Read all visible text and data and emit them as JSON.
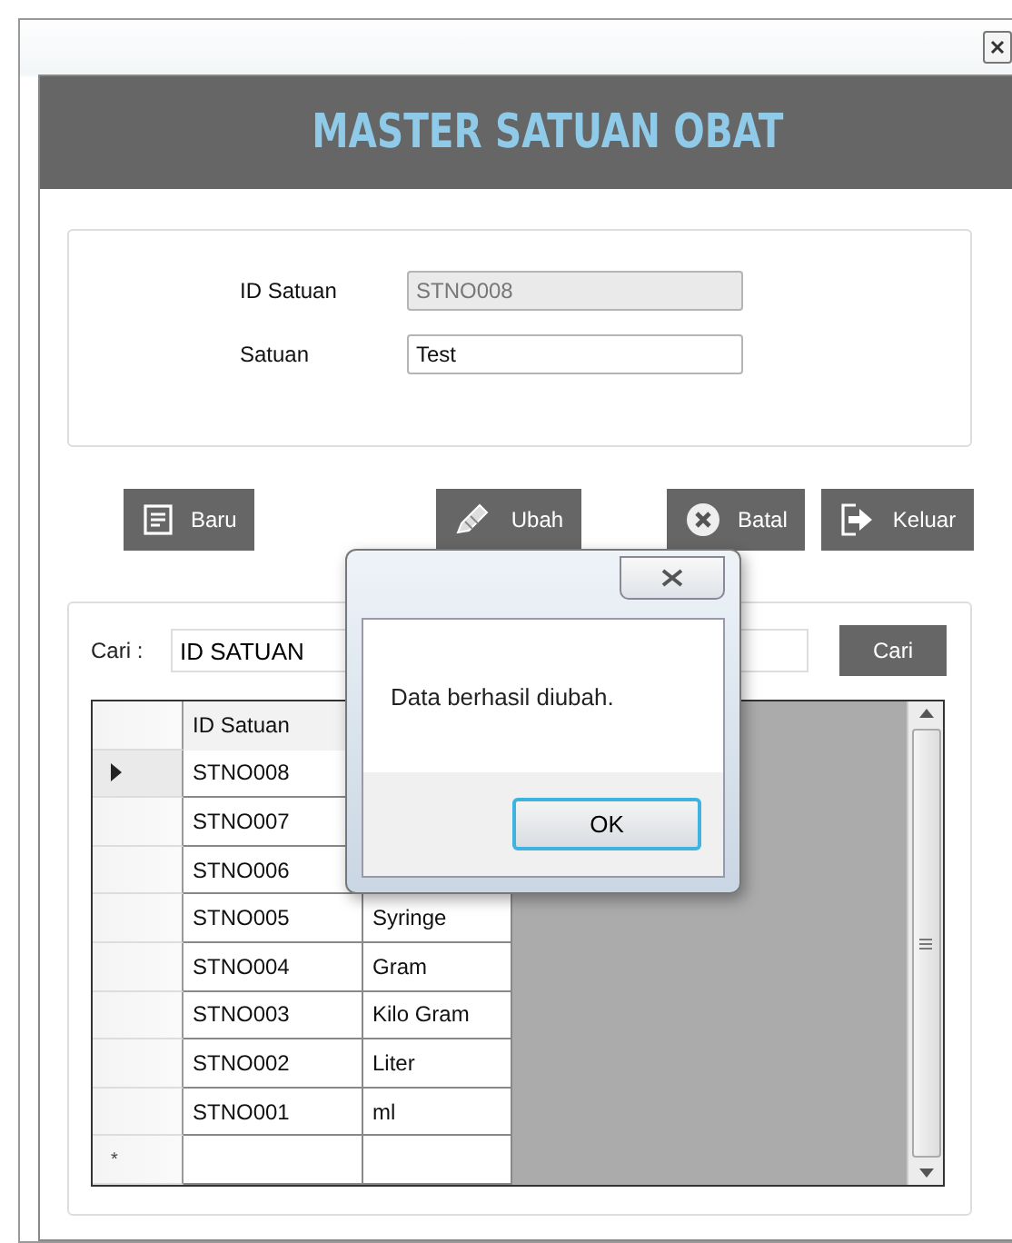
{
  "window": {
    "title": "MASTER SATUAN OBAT"
  },
  "form": {
    "fields": [
      {
        "label": "ID Satuan",
        "value": "STNO008",
        "disabled": true
      },
      {
        "label": "Satuan",
        "value": "Test",
        "disabled": false
      }
    ]
  },
  "buttons": [
    {
      "label": "Baru",
      "kind": "new"
    },
    {
      "label": "Ubah",
      "kind": "edit"
    },
    {
      "label": "Batal",
      "kind": "cancel"
    },
    {
      "label": "Keluar",
      "kind": "exit"
    }
  ],
  "search": {
    "label": "Cari :",
    "value": "ID SATUAN",
    "button": "Cari"
  },
  "table": {
    "columns": [
      "ID Satuan"
    ],
    "rows": [
      {
        "id": "STNO008",
        "selected": true
      },
      {
        "id": "STNO007",
        "selected": false
      },
      {
        "id": "STNO006",
        "selected": false
      },
      {
        "id": "STNO005",
        "satuan": "Syringe",
        "selected": false
      },
      {
        "id": "STNO004",
        "satuan": "Gram",
        "selected": false
      },
      {
        "id": "STNO003",
        "satuan": "Kilo Gram",
        "selected": false
      },
      {
        "id": "STNO002",
        "satuan": "Liter",
        "selected": false
      },
      {
        "id": "STNO001",
        "satuan": "ml",
        "selected": false
      }
    ],
    "new_row_marker": "*"
  },
  "dialog": {
    "message": "Data berhasil diubah.",
    "button": "OK"
  }
}
